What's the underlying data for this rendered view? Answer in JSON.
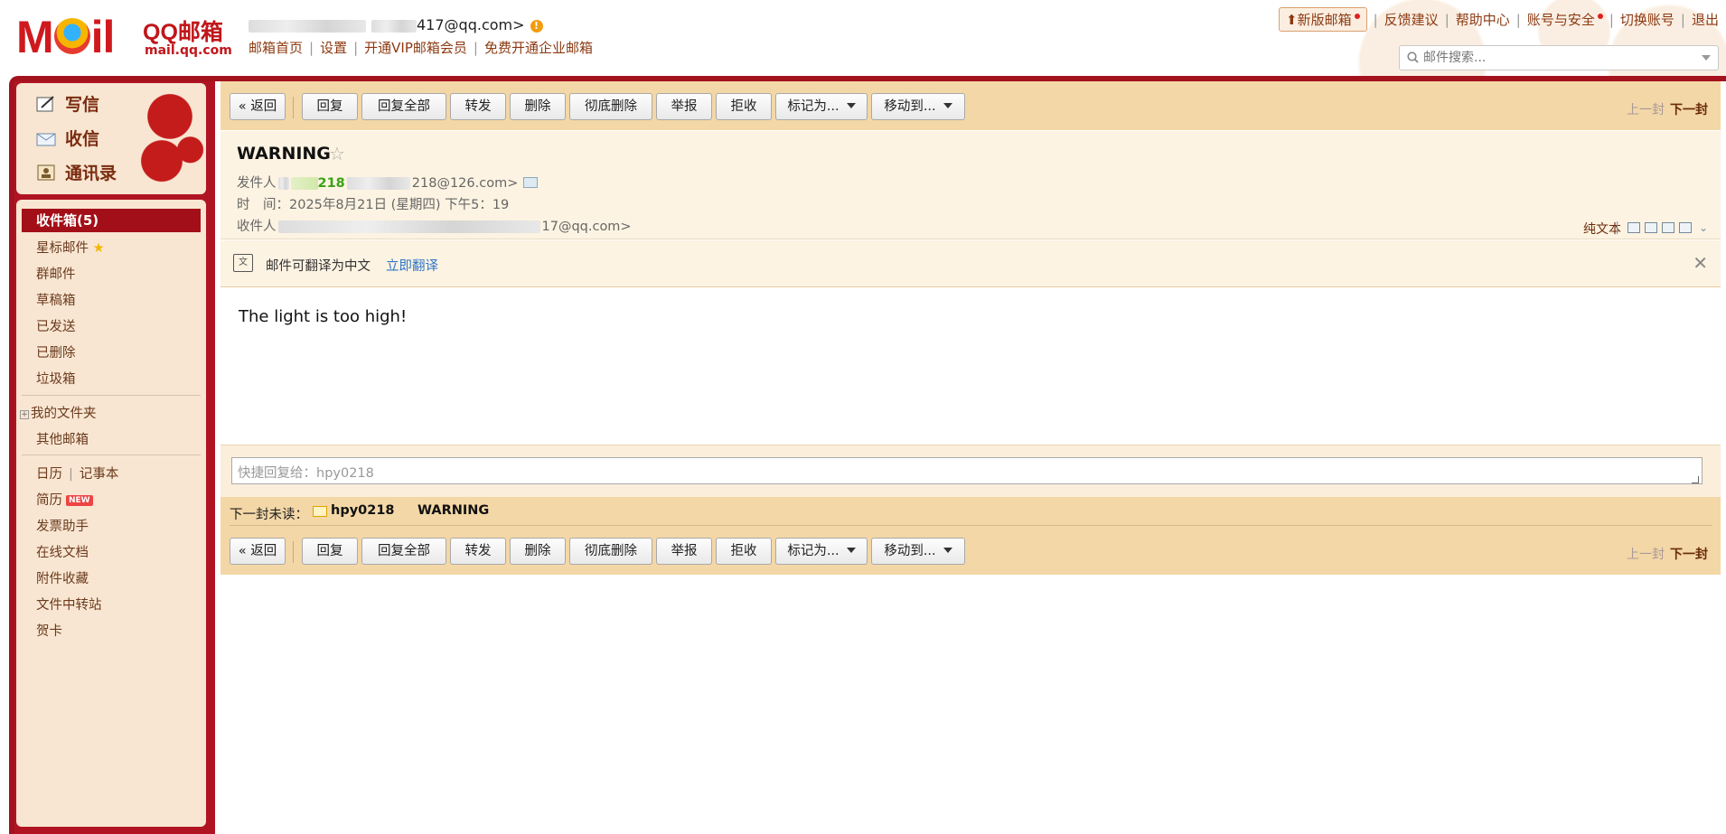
{
  "logo": {
    "brand": "MOIL",
    "product": "QQ邮箱",
    "domain": "mail.qq.com"
  },
  "account": {
    "email_suffix": "417@qq.com>"
  },
  "top_links": [
    "邮箱首页",
    "设置",
    "开通VIP邮箱会员",
    "免费开通企业邮箱"
  ],
  "right_links": {
    "new_version": "新版邮箱",
    "items": [
      "反馈建议",
      "帮助中心",
      "账号与安全",
      "切换账号",
      "退出"
    ]
  },
  "search": {
    "placeholder": "邮件搜索..."
  },
  "quick_actions": [
    "写信",
    "收信",
    "通讯录"
  ],
  "nav": {
    "inbox": "收件箱(5)",
    "starred": "星标邮件",
    "group": "群邮件",
    "drafts": "草稿箱",
    "sent": "已发送",
    "deleted": "已删除",
    "spam": "垃圾箱",
    "my_folders": "我的文件夹",
    "other_mail": "其他邮箱",
    "calendar": "日历",
    "notes": "记事本",
    "resume": "简历",
    "resume_badge": "NEW",
    "invoice": "发票助手",
    "docs": "在线文档",
    "attachments": "附件收藏",
    "transfer": "文件中转站",
    "cards": "贺卡"
  },
  "toolbar": {
    "back": "« 返回",
    "reply": "回复",
    "reply_all": "回复全部",
    "forward": "转发",
    "delete": "删除",
    "purge": "彻底删除",
    "report": "举报",
    "reject": "拒收",
    "mark_as": "标记为...",
    "move_to": "移动到...",
    "prev": "上一封",
    "next": "下一封"
  },
  "mail": {
    "subject": "WARNING",
    "from_label": "发件人",
    "from_name": "218",
    "from_email_suffix": "218@126.com>",
    "time_label": "时　间：",
    "time": "2025年8月21日 (星期四) 下午5：19",
    "to_label": "收件人",
    "to_suffix": "17@qq.com>",
    "plain_text": "纯文本",
    "body": "The light is too high!"
  },
  "translate": {
    "text": "邮件可翻译为中文",
    "link": "立即翻译"
  },
  "quick_reply": {
    "placeholder": "快捷回复给：hpy0218"
  },
  "next_unread": {
    "label": "下一封未读：",
    "from": "hpy0218",
    "subject": "WARNING"
  },
  "colors": {
    "brand_red": "#a4121d",
    "toolbar_bg": "#f3d7a6",
    "link_brown": "#8c3a12"
  }
}
